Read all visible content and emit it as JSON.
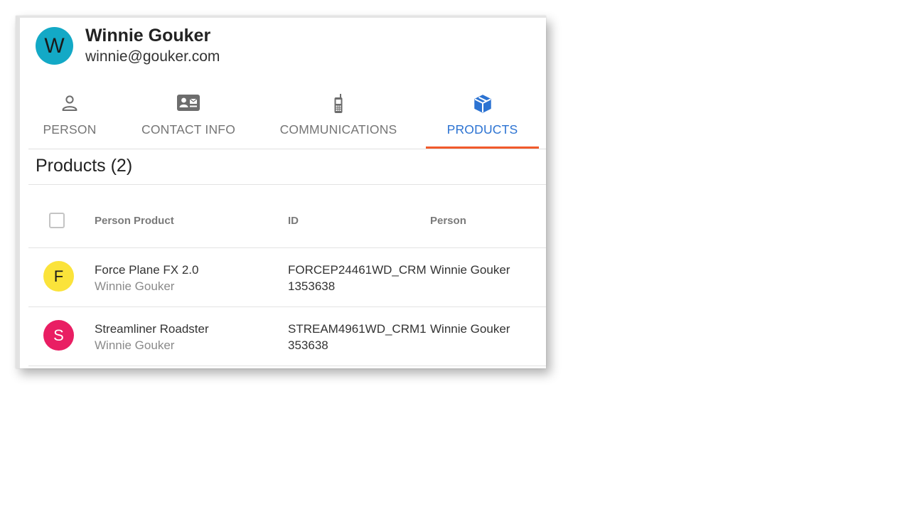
{
  "contact": {
    "initial": "W",
    "name": "Winnie Gouker",
    "email": "winnie@gouker.com",
    "avatar_color": "#13a9c6"
  },
  "tabs": [
    {
      "label": "PERSON",
      "icon": "person-icon",
      "active": false
    },
    {
      "label": "CONTACT INFO",
      "icon": "contact-card-icon",
      "active": false
    },
    {
      "label": "COMMUNICATIONS",
      "icon": "mobile-phone-icon",
      "active": false
    },
    {
      "label": "PRODUCTS",
      "icon": "box-icon",
      "active": true
    }
  ],
  "colors": {
    "active_tab": "#2c73d2",
    "tab_indicator": "#f15a2b"
  },
  "products": {
    "title": "Products (2)",
    "columns": [
      "Person Product",
      "ID",
      "Person"
    ],
    "rows": [
      {
        "initial": "F",
        "avatar_color": "#fbe33a",
        "initial_color": "#1a1a1a",
        "product": "Force Plane FX 2.0",
        "product_sub": "Winnie Gouker",
        "id_line1": "FORCEP24461WD_CRM",
        "id_line2": "1353638",
        "person": "Winnie Gouker"
      },
      {
        "initial": "S",
        "avatar_color": "#e91e63",
        "initial_color": "#ffffff",
        "product": "Streamliner Roadster",
        "product_sub": "Winnie Gouker",
        "id_line1": "STREAM4961WD_CRM1",
        "id_line2": "353638",
        "person": "Winnie Gouker"
      }
    ]
  }
}
